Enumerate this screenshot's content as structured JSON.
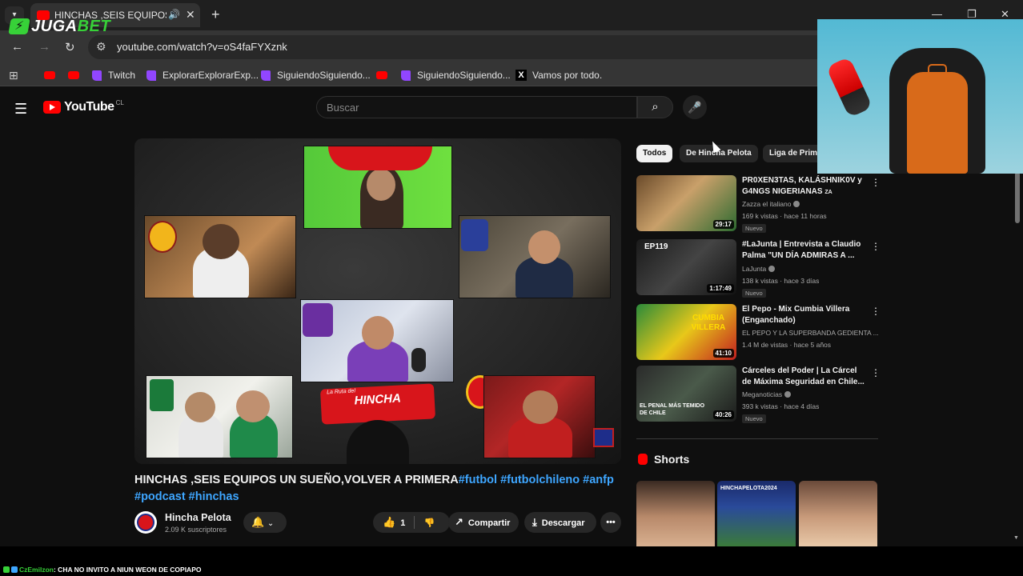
{
  "browser": {
    "tab_title": "HINCHAS ,SEIS EQUIPOS UN SUEÑO,VOLVER A PRIMERA",
    "url": "youtube.com/watch?v=oS4faFYXznk",
    "bookmarks": [
      {
        "label": ""
      },
      {
        "label": ""
      },
      {
        "label": "Twitch"
      },
      {
        "label": "ExplorarExplorarExp..."
      },
      {
        "label": "SiguiendoSiguiendo..."
      },
      {
        "label": ""
      },
      {
        "label": "SiguiendoSiguiendo..."
      },
      {
        "label": "Vamos por todo."
      }
    ]
  },
  "overlay": {
    "brand_part1": "JUGA",
    "brand_part2": "BET",
    "bolt": "⚡"
  },
  "youtube": {
    "logo_text": "YouTube",
    "region": "CL",
    "search_placeholder": "Buscar",
    "banner_text": "HINCHA",
    "banner_sub": "La Ruta del",
    "video_title": "HINCHAS ,SEIS EQUIPOS UN SUEÑO,VOLVER A PRIMERA",
    "video_tags": "#futbol #futbolchileno #anfp #podcast #hinchas",
    "channel_name": "Hincha Pelota",
    "channel_subs": "2.09 K suscriptores",
    "like_count": "1",
    "share_label": "Compartir",
    "download_label": "Descargar",
    "chips": [
      "Todos",
      "De Hincha Pelota",
      "Liga de Prim"
    ],
    "recommendations": [
      {
        "title": "PR0XEN3TAS, KALÁSHNIK0V y G4NGS NIGERIANAS",
        "suffix": "ZA",
        "channel": "Zazza el italiano",
        "meta": "169 k vistas · hace 11 horas",
        "badge": "Nuevo",
        "duration": "29:17"
      },
      {
        "title": "#LaJunta | Entrevista a Claudio Palma \"UN DÍA ADMIRAS A ...",
        "suffix": "",
        "channel": "LaJunta",
        "meta": "138 k vistas · hace 3 días",
        "badge": "Nuevo",
        "duration": "1:17:49",
        "thumb_text": "EP119"
      },
      {
        "title": "El Pepo - Mix Cumbia Villera (Enganchado)",
        "suffix": "",
        "channel": "EL PEPO Y LA SUPERBANDA GEDIENTA ...",
        "meta": "1.4 M de vistas · hace 5 años",
        "badge": "",
        "duration": "41:10",
        "thumb_text": "CUMBIA VILLERA"
      },
      {
        "title": "Cárceles del Poder | La Cárcel de Máxima Seguridad en Chile...",
        "suffix": "",
        "channel": "Meganoticias",
        "meta": "393 k vistas · hace 4 días",
        "badge": "Nuevo",
        "duration": "40:26",
        "thumb_text": "EL PENAL MÁS TEMIDO DE CHILE"
      }
    ],
    "shorts_label": "Shorts",
    "short_texts": [
      "",
      "HINCHAPELOTA2024",
      ""
    ]
  },
  "chat": {
    "user": "CzEmilzon",
    "message": ": CHA NO INVITO A NIUN WEON DE COPIAPO"
  },
  "colors": {
    "youtube_red": "#ff0000",
    "link_blue": "#3ea6ff",
    "jugabet_green": "#37d138",
    "twitch_purple": "#9146ff"
  }
}
